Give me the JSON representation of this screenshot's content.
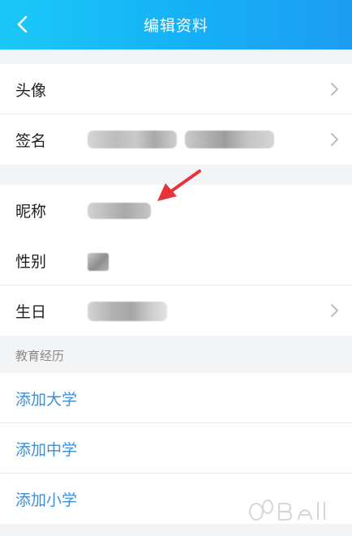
{
  "header": {
    "title": "编辑资料",
    "background": "#16b0f6"
  },
  "profile": {
    "avatar_label": "头像",
    "signature_label": "签名",
    "nickname_label": "昵称",
    "gender_label": "性别",
    "birthday_label": "生日"
  },
  "education": {
    "section_title": "教育经历",
    "add_university": "添加大学",
    "add_high_school": "添加中学",
    "add_primary_school": "添加小学",
    "link_color": "#3a8fd6"
  },
  "annotation": {
    "arrow_color": "#e8333a"
  }
}
